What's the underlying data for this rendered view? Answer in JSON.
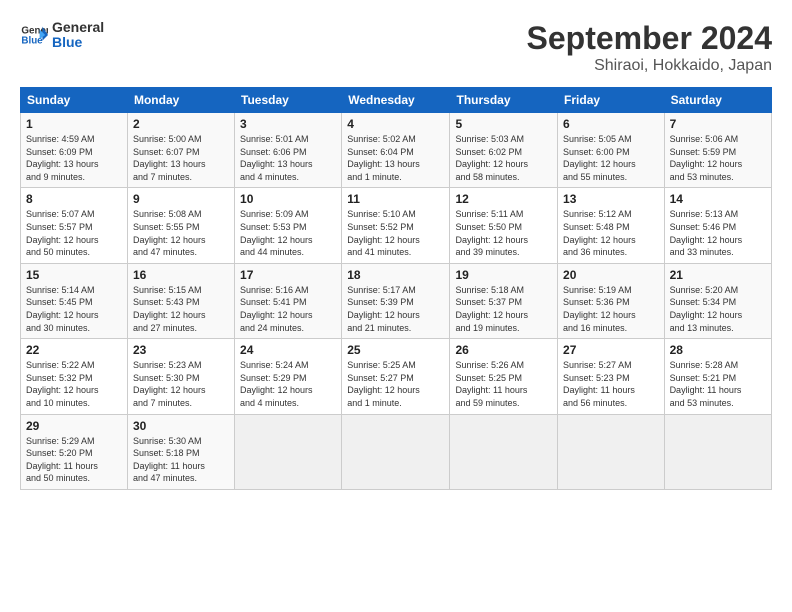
{
  "logo": {
    "line1": "General",
    "line2": "Blue"
  },
  "title": "September 2024",
  "subtitle": "Shiraoi, Hokkaido, Japan",
  "days_header": [
    "Sunday",
    "Monday",
    "Tuesday",
    "Wednesday",
    "Thursday",
    "Friday",
    "Saturday"
  ],
  "weeks": [
    [
      {
        "day": "1",
        "info": "Sunrise: 4:59 AM\nSunset: 6:09 PM\nDaylight: 13 hours\nand 9 minutes."
      },
      {
        "day": "2",
        "info": "Sunrise: 5:00 AM\nSunset: 6:07 PM\nDaylight: 13 hours\nand 7 minutes."
      },
      {
        "day": "3",
        "info": "Sunrise: 5:01 AM\nSunset: 6:06 PM\nDaylight: 13 hours\nand 4 minutes."
      },
      {
        "day": "4",
        "info": "Sunrise: 5:02 AM\nSunset: 6:04 PM\nDaylight: 13 hours\nand 1 minute."
      },
      {
        "day": "5",
        "info": "Sunrise: 5:03 AM\nSunset: 6:02 PM\nDaylight: 12 hours\nand 58 minutes."
      },
      {
        "day": "6",
        "info": "Sunrise: 5:05 AM\nSunset: 6:00 PM\nDaylight: 12 hours\nand 55 minutes."
      },
      {
        "day": "7",
        "info": "Sunrise: 5:06 AM\nSunset: 5:59 PM\nDaylight: 12 hours\nand 53 minutes."
      }
    ],
    [
      {
        "day": "8",
        "info": "Sunrise: 5:07 AM\nSunset: 5:57 PM\nDaylight: 12 hours\nand 50 minutes."
      },
      {
        "day": "9",
        "info": "Sunrise: 5:08 AM\nSunset: 5:55 PM\nDaylight: 12 hours\nand 47 minutes."
      },
      {
        "day": "10",
        "info": "Sunrise: 5:09 AM\nSunset: 5:53 PM\nDaylight: 12 hours\nand 44 minutes."
      },
      {
        "day": "11",
        "info": "Sunrise: 5:10 AM\nSunset: 5:52 PM\nDaylight: 12 hours\nand 41 minutes."
      },
      {
        "day": "12",
        "info": "Sunrise: 5:11 AM\nSunset: 5:50 PM\nDaylight: 12 hours\nand 39 minutes."
      },
      {
        "day": "13",
        "info": "Sunrise: 5:12 AM\nSunset: 5:48 PM\nDaylight: 12 hours\nand 36 minutes."
      },
      {
        "day": "14",
        "info": "Sunrise: 5:13 AM\nSunset: 5:46 PM\nDaylight: 12 hours\nand 33 minutes."
      }
    ],
    [
      {
        "day": "15",
        "info": "Sunrise: 5:14 AM\nSunset: 5:45 PM\nDaylight: 12 hours\nand 30 minutes."
      },
      {
        "day": "16",
        "info": "Sunrise: 5:15 AM\nSunset: 5:43 PM\nDaylight: 12 hours\nand 27 minutes."
      },
      {
        "day": "17",
        "info": "Sunrise: 5:16 AM\nSunset: 5:41 PM\nDaylight: 12 hours\nand 24 minutes."
      },
      {
        "day": "18",
        "info": "Sunrise: 5:17 AM\nSunset: 5:39 PM\nDaylight: 12 hours\nand 21 minutes."
      },
      {
        "day": "19",
        "info": "Sunrise: 5:18 AM\nSunset: 5:37 PM\nDaylight: 12 hours\nand 19 minutes."
      },
      {
        "day": "20",
        "info": "Sunrise: 5:19 AM\nSunset: 5:36 PM\nDaylight: 12 hours\nand 16 minutes."
      },
      {
        "day": "21",
        "info": "Sunrise: 5:20 AM\nSunset: 5:34 PM\nDaylight: 12 hours\nand 13 minutes."
      }
    ],
    [
      {
        "day": "22",
        "info": "Sunrise: 5:22 AM\nSunset: 5:32 PM\nDaylight: 12 hours\nand 10 minutes."
      },
      {
        "day": "23",
        "info": "Sunrise: 5:23 AM\nSunset: 5:30 PM\nDaylight: 12 hours\nand 7 minutes."
      },
      {
        "day": "24",
        "info": "Sunrise: 5:24 AM\nSunset: 5:29 PM\nDaylight: 12 hours\nand 4 minutes."
      },
      {
        "day": "25",
        "info": "Sunrise: 5:25 AM\nSunset: 5:27 PM\nDaylight: 12 hours\nand 1 minute."
      },
      {
        "day": "26",
        "info": "Sunrise: 5:26 AM\nSunset: 5:25 PM\nDaylight: 11 hours\nand 59 minutes."
      },
      {
        "day": "27",
        "info": "Sunrise: 5:27 AM\nSunset: 5:23 PM\nDaylight: 11 hours\nand 56 minutes."
      },
      {
        "day": "28",
        "info": "Sunrise: 5:28 AM\nSunset: 5:21 PM\nDaylight: 11 hours\nand 53 minutes."
      }
    ],
    [
      {
        "day": "29",
        "info": "Sunrise: 5:29 AM\nSunset: 5:20 PM\nDaylight: 11 hours\nand 50 minutes."
      },
      {
        "day": "30",
        "info": "Sunrise: 5:30 AM\nSunset: 5:18 PM\nDaylight: 11 hours\nand 47 minutes."
      },
      {
        "day": "",
        "info": ""
      },
      {
        "day": "",
        "info": ""
      },
      {
        "day": "",
        "info": ""
      },
      {
        "day": "",
        "info": ""
      },
      {
        "day": "",
        "info": ""
      }
    ]
  ]
}
